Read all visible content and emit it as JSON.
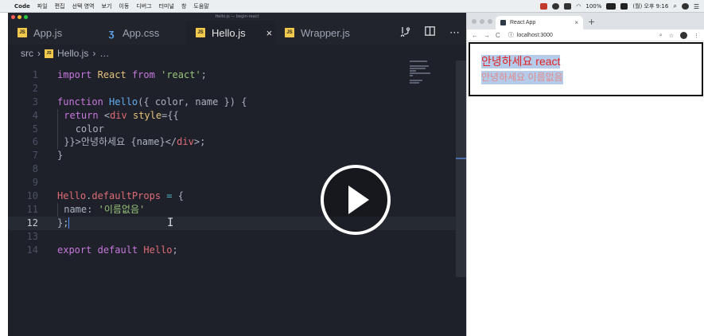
{
  "menubar": {
    "app": "Code",
    "items": [
      "파일",
      "편집",
      "선택 영역",
      "보기",
      "이동",
      "디버그",
      "터미널",
      "창",
      "도움말"
    ],
    "battery": "100%",
    "clock": "(월) 오후 9:16"
  },
  "window": {
    "title": "Hello.js — begin-react"
  },
  "tabs": [
    {
      "label": "App.js",
      "icon": "JS"
    },
    {
      "label": "App.css",
      "icon": "css-icon"
    },
    {
      "label": "Hello.js",
      "icon": "JS",
      "active": true
    },
    {
      "label": "Wrapper.js",
      "icon": "JS"
    }
  ],
  "tab_close": "×",
  "breadcrumb": {
    "folder": "src",
    "file": "Hello.js",
    "sep": "›",
    "rest": "…",
    "icon": "JS"
  },
  "code": {
    "current_line": 12,
    "lines": [
      {
        "n": "1"
      },
      {
        "n": "2"
      },
      {
        "n": "3"
      },
      {
        "n": "4"
      },
      {
        "n": "5"
      },
      {
        "n": "6"
      },
      {
        "n": "7"
      },
      {
        "n": "8"
      },
      {
        "n": "9"
      },
      {
        "n": "10"
      },
      {
        "n": "11"
      },
      {
        "n": "12"
      },
      {
        "n": "13"
      },
      {
        "n": "14"
      }
    ],
    "tokens": {
      "l1_import": "import",
      "l1_react": "React",
      "l1_from": "from",
      "l1_mod": "'react'",
      "l1_semi": ";",
      "l3_function": "function",
      "l3_name": "Hello",
      "l3_params": "({ color, name }) {",
      "l4_return": "return",
      "l4_open": "<",
      "l4_div": "div",
      "l4_style": "style",
      "l4_rest": "={{",
      "l5_color": "color",
      "l6_close": "}}>",
      "l6_text": "안녕하세요 {name}",
      "l6_endtag": "</",
      "l6_div": "div",
      "l6_end": ">;",
      "l7_brace": "}",
      "l10_hello": "Hello",
      "l10_dot": ".",
      "l10_prop": "defaultProps",
      "l10_eq": "=",
      "l10_brace": "{",
      "l11_key": "name",
      "l11_colon": ":",
      "l11_val": "'이름없음'",
      "l12_end": "};",
      "l14_export": "export",
      "l14_default": "default",
      "l14_hello": "Hello",
      "l14_semi": ";"
    }
  },
  "browser": {
    "tab_title": "React App",
    "tab_close": "×",
    "new_tab": "+",
    "url": "localhost:3000",
    "line1": "안녕하세요 react",
    "line2": "안녕하세요 이름없음"
  },
  "colors": {
    "editor_bg": "#1e2129",
    "accent": "#528bff",
    "red_text": "#e02424",
    "selection": "#b5cbea"
  }
}
